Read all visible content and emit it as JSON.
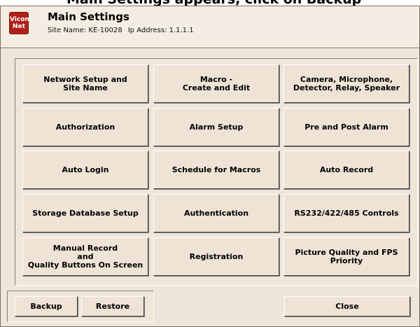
{
  "top_caption": "Main Settings appears, click on Backup",
  "logo": {
    "line1": "Vicon",
    "line2": "Net"
  },
  "header": {
    "title": "Main Settings",
    "site_label": "Site Name: KE-10028",
    "ip_label": "Ip Address: 1.1.1.1"
  },
  "grid_buttons": [
    "Network Setup and\nSite Name",
    "Macro -\nCreate and Edit",
    "Camera,  Microphone,\nDetector, Relay, Speaker",
    "Authorization",
    "Alarm Setup",
    "Pre and Post Alarm",
    "Auto Login",
    "Schedule for Macros",
    "Auto Record",
    "Storage Database Setup",
    "Authentication",
    "RS232/422/485 Controls",
    "Manual Record\nand\nQuality Buttons On Screen",
    "Registration",
    "Picture Quality and FPS\nPriority"
  ],
  "footer": {
    "backup": "Backup",
    "restore": "Restore",
    "close": "Close"
  },
  "colors": {
    "background": "#efe6da",
    "button_face": "#efe3d6",
    "logo_red": "#b0201a"
  }
}
